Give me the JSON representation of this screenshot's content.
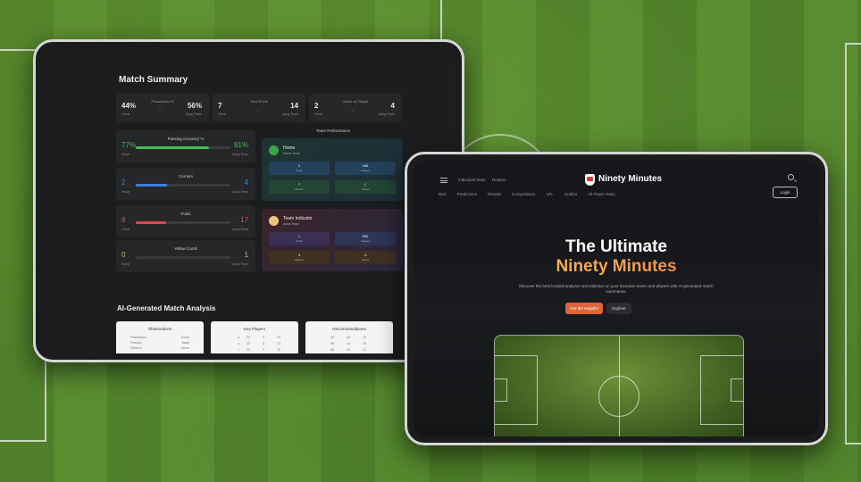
{
  "dashboard": {
    "title": "Match Summary",
    "stats": [
      {
        "left": "44%",
        "label": "Possession %",
        "right": "56%",
        "sub_left": "Home",
        "sub_right": "Away Team"
      },
      {
        "left": "7",
        "label": "Total Shots",
        "right": "14",
        "sub_left": "Home",
        "sub_right": "Away Team"
      },
      {
        "left": "2",
        "label": "Shots on Target",
        "right": "4",
        "sub_left": "Home",
        "sub_right": "Away Team"
      }
    ],
    "metrics": [
      {
        "name": "Passing Accuracy %",
        "left": "77%",
        "right": "81%",
        "fill": 0.77,
        "color": "#3fbf4f",
        "sub_left": "Home",
        "sub_right": "Away Team"
      },
      {
        "name": "Corners",
        "left": "2",
        "right": "4",
        "fill": 0.33,
        "color": "#3b7fe0",
        "sub_left": "Home",
        "sub_right": "Away Team"
      },
      {
        "name": "Fouls",
        "left": "8",
        "right": "17",
        "fill": 0.32,
        "color": "#e0474c",
        "sub_left": "Home",
        "sub_right": "Away Team"
      },
      {
        "name": "Yellow Cards",
        "left": "0",
        "right": "1",
        "fill": 0.0,
        "color": "#e0b43b",
        "sub_left": "Home",
        "sub_right": "Away Team"
      }
    ],
    "team_performance": {
      "title": "Team Performance",
      "teams": [
        {
          "name": "Home",
          "sub": "Home Team",
          "badge_color": "#3fa34d",
          "cells": [
            {
              "v": "1",
              "l": "Goals"
            },
            {
              "v": "448",
              "l": "Passes"
            },
            {
              "v": "7",
              "l": "Tackles"
            },
            {
              "v": "2",
              "l": "Saves"
            }
          ]
        },
        {
          "name": "Team Indicator",
          "sub": "Away Team",
          "badge_color": "#e8c77a",
          "cells": [
            {
              "v": "1",
              "l": "Goals"
            },
            {
              "v": "506",
              "l": "Passes"
            },
            {
              "v": "3",
              "l": "Tackles"
            },
            {
              "v": "3",
              "l": "Saves"
            }
          ]
        }
      ]
    },
    "ai_title": "AI-Generated Match Analysis",
    "ai_cards": [
      {
        "title": "Observations",
        "rows": [
          [
            "Possession",
            "Home"
          ],
          [
            "Passing",
            "Away"
          ],
          [
            "Defence",
            "Home"
          ]
        ],
        "stars": [
          "★",
          "★",
          "★",
          "★"
        ]
      },
      {
        "title": "Key Players",
        "rows": [
          [
            "34",
            "8",
            "15"
          ],
          [
            "43",
            "8",
            "13"
          ],
          [
            "12",
            "4",
            "15"
          ],
          [
            "23",
            "8",
            "13"
          ]
        ],
        "stars": []
      },
      {
        "title": "Recommendations",
        "rows": [
          [
            "38",
            "18",
            "19"
          ],
          [
            "55",
            "16",
            "19"
          ],
          [
            "88",
            "28",
            "13"
          ]
        ],
        "stars": [
          "★",
          "★",
          "★",
          "★"
        ]
      }
    ]
  },
  "landing": {
    "nav_left": [
      "Individual Stats",
      "Rosters"
    ],
    "brand": "Ninety Minutes",
    "nav_links": [
      "Bios",
      "Predictions",
      "Results",
      "Competitions",
      "UFL",
      "Guides",
      "All Player Stats"
    ],
    "login": "Login",
    "hero_line1": "The Ultimate",
    "hero_line2": "Ninety Minutes",
    "hero_desc": "Discover the best football analysis and statistics on your favourite teams and players with AI-generated match summaries.",
    "cta_primary": "Get the Insights",
    "cta_secondary": "Explore"
  }
}
